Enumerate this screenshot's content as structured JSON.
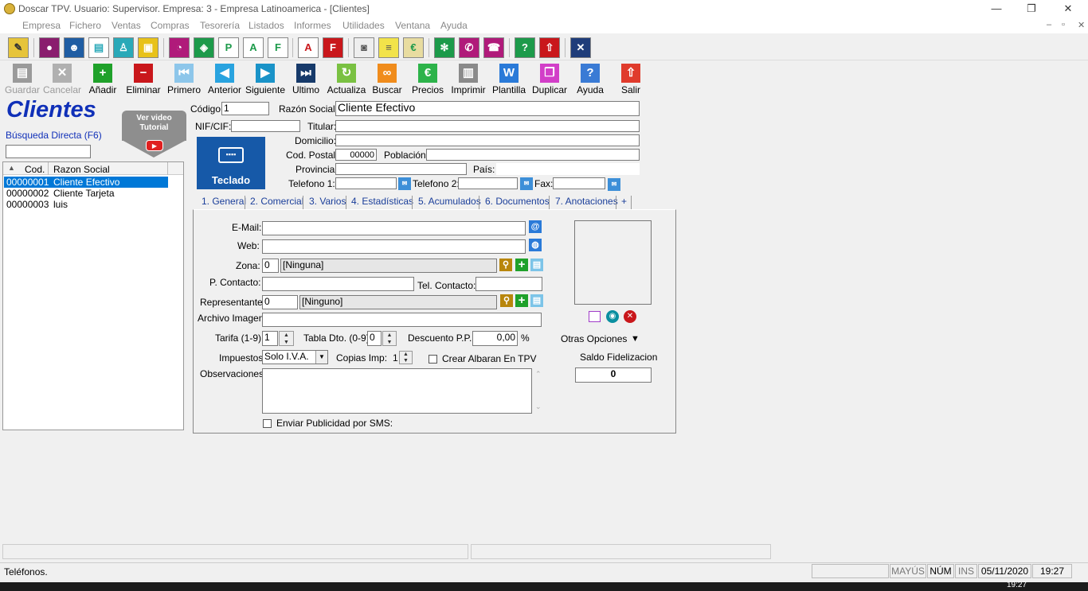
{
  "window": {
    "title": "Doscar TPV. Usuario: Supervisor. Empresa: 3 - Empresa Latinoamerica - [Clientes]",
    "minimize": "—",
    "restore": "❐",
    "close": "✕"
  },
  "menu": [
    "Empresa",
    "Fichero",
    "Ventas",
    "Compras",
    "Tesorería",
    "Listados",
    "Informes",
    "Utilidades",
    "Ventana",
    "Ayuda"
  ],
  "mdi_controls": {
    "minimize": "–",
    "restore": "▫",
    "close": "✕"
  },
  "toolbar2": [
    {
      "label": "Guardar",
      "icon": "save-icon",
      "glyph": "▤",
      "color": "#9a9a9a",
      "enabled": false
    },
    {
      "label": "Cancelar",
      "icon": "cancel-icon",
      "glyph": "✕",
      "color": "#b0b0b0",
      "enabled": false
    },
    {
      "label": "Añadir",
      "icon": "plus-icon",
      "glyph": "+",
      "color": "#1fa12a",
      "enabled": true
    },
    {
      "label": "Eliminar",
      "icon": "minus-icon",
      "glyph": "−",
      "color": "#c9171b",
      "enabled": true
    },
    {
      "label": "Primero",
      "icon": "first-icon",
      "glyph": "⏮",
      "color": "#8dc6ea",
      "enabled": true
    },
    {
      "label": "Anterior",
      "icon": "previous-icon",
      "glyph": "◀",
      "color": "#29a3df",
      "enabled": true
    },
    {
      "label": "Siguiente",
      "icon": "next-icon",
      "glyph": "▶",
      "color": "#1a93c8",
      "enabled": true
    },
    {
      "label": "Ultimo",
      "icon": "last-icon",
      "glyph": "⏭",
      "color": "#173a6a",
      "enabled": true
    },
    {
      "label": "Actualiza",
      "icon": "refresh-icon",
      "glyph": "↻",
      "color": "#7ac142",
      "enabled": true
    },
    {
      "label": "Buscar",
      "icon": "binoculars-icon",
      "glyph": "∞",
      "color": "#f08c1c",
      "enabled": true
    },
    {
      "label": "Precios",
      "icon": "euro-icon",
      "glyph": "€",
      "color": "#2db34a",
      "enabled": true
    },
    {
      "label": "Imprimir",
      "icon": "printer-icon",
      "glyph": "▥",
      "color": "#8a8a8a",
      "enabled": true
    },
    {
      "label": "Plantilla",
      "icon": "word-icon",
      "glyph": "W",
      "color": "#2a7ad8",
      "enabled": true
    },
    {
      "label": "Duplicar",
      "icon": "duplicate-icon",
      "glyph": "❐",
      "color": "#d23ec8",
      "enabled": true
    },
    {
      "label": "Ayuda",
      "icon": "help-icon",
      "glyph": "?",
      "color": "#3a7bd5",
      "enabled": true
    },
    {
      "label": "Salir",
      "icon": "exit-icon",
      "glyph": "⇧",
      "color": "#e03b2c",
      "enabled": true
    }
  ],
  "left": {
    "title": "Clientes",
    "search_label": "Búsqueda Directa (F6)",
    "search_value": "",
    "video_button": "Ver video\nTutorial",
    "list_headers": [
      "Cod.",
      "Razon Social"
    ],
    "rows": [
      {
        "code": "00000001",
        "name": "Cliente Efectivo",
        "selected": true
      },
      {
        "code": "00000002",
        "name": "Cliente Tarjeta",
        "selected": false
      },
      {
        "code": "00000003",
        "name": "luis",
        "selected": false
      }
    ]
  },
  "keyboard_button": "Teclado",
  "form": {
    "codigo_label": "Código:",
    "codigo": "1",
    "razon_label": "Razón Social:",
    "razon": "Cliente Efectivo",
    "nif_label": "NIF/CIF:",
    "nif": "",
    "titular_label": "Titular:",
    "titular": "",
    "domicilio_label": "Domicilio:",
    "domicilio": "",
    "cp_label": "Cod. Postal:",
    "cp": "00000",
    "poblacion_label": "Población:",
    "poblacion": "",
    "provincia_label": "Provincia:",
    "provincia": "",
    "pais_label": "País:",
    "pais": "",
    "tel1_label": "Telefono 1:",
    "tel1": "",
    "tel2_label": "Telefono 2:",
    "tel2": "",
    "fax_label": "Fax:",
    "fax": ""
  },
  "tabs": [
    "1. General",
    "2. Comercial",
    "3. Varios",
    "4. Estadísticas",
    "5. Acumulados",
    "6. Documentos",
    "7. Anotaciones",
    "+"
  ],
  "general": {
    "email_label": "E-Mail:",
    "email": "",
    "web_label": "Web:",
    "web": "",
    "zona_label": "Zona:",
    "zona_code": "0",
    "zona_name": "[Ninguna]",
    "contacto_label": "P. Contacto:",
    "contacto": "",
    "telcontacto_label": "Tel. Contacto:",
    "telcontacto": "",
    "repr_label": "Representante:",
    "repr_code": "0",
    "repr_name": "[Ninguno]",
    "imagen_label": "Archivo Imagen:",
    "imagen": "",
    "tarifa_label": "Tarifa (1-9):",
    "tarifa": "1",
    "tabla_label": "Tabla Dto. (0-9):",
    "tabla": "0",
    "dto_label": "Descuento P.P.",
    "dto": "0,00",
    "pct": "%",
    "impuestos_label": "Impuestos:",
    "impuestos": "Solo I.V.A.",
    "copias_label": "Copias Imp:",
    "copias": "1",
    "crear_albaran": "Crear Albaran En TPV",
    "obs_label": "Observaciones:",
    "obs": "",
    "sms": "Enviar Publicidad por SMS:",
    "otras": "Otras Opciones",
    "saldo_label": "Saldo Fidelizacion",
    "saldo": "0"
  },
  "status": {
    "left": "Teléfonos.",
    "mayus": "MAYÚS",
    "num": "NÚM",
    "ins": "INS",
    "date": "05/11/2020",
    "time": "19:27"
  },
  "taskbar_clock": "19:27"
}
